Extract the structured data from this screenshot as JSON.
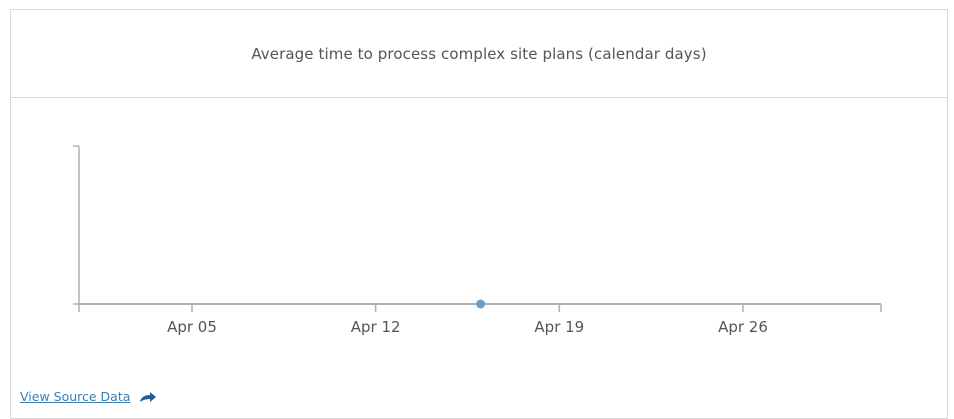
{
  "chart_data": {
    "type": "line",
    "title": "Average time to process complex site plans (calendar days)",
    "xlabel": "",
    "ylabel": "",
    "x_ticks": [
      "Apr 05",
      "Apr 12",
      "Apr 19",
      "Apr 26"
    ],
    "series": [
      {
        "points": [
          {
            "x": "Apr 16",
            "y": 0
          }
        ]
      }
    ],
    "grid": false,
    "legend": "none",
    "colors": {
      "axis": "#b0b0b0",
      "point": "#6a9fc8"
    }
  },
  "footer": {
    "source_link_label": "View Source Data",
    "source_link_icon": "share-arrow-icon",
    "link_color": "#3a7fb3"
  }
}
